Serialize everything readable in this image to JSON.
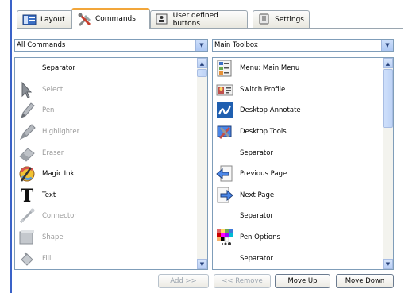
{
  "tabs": [
    {
      "label": "Layout",
      "icon": "layout-icon"
    },
    {
      "label": "Commands",
      "icon": "tools-icon",
      "active": true
    },
    {
      "label": "User defined buttons",
      "icon": "user-button-icon"
    },
    {
      "label": "Settings",
      "icon": "settings-icon"
    }
  ],
  "left_combo": {
    "value": "All Commands"
  },
  "right_combo": {
    "value": "Main Toolbox"
  },
  "left_list": [
    {
      "label": "Separator",
      "icon": "",
      "enabled": true
    },
    {
      "label": "Select",
      "icon": "select-arrow-icon",
      "enabled": false
    },
    {
      "label": "Pen",
      "icon": "pen-icon",
      "enabled": false
    },
    {
      "label": "Highlighter",
      "icon": "highlighter-icon",
      "enabled": false
    },
    {
      "label": "Eraser",
      "icon": "eraser-icon",
      "enabled": false
    },
    {
      "label": "Magic Ink",
      "icon": "magic-ink-icon",
      "enabled": true
    },
    {
      "label": "Text",
      "icon": "text-icon",
      "enabled": true
    },
    {
      "label": "Connector",
      "icon": "connector-icon",
      "enabled": false
    },
    {
      "label": "Shape",
      "icon": "shape-icon",
      "enabled": false
    },
    {
      "label": "Fill",
      "icon": "fill-icon",
      "enabled": false
    }
  ],
  "right_list": [
    {
      "label": "Menu: Main Menu",
      "icon": "main-menu-icon"
    },
    {
      "label": "Switch Profile",
      "icon": "switch-profile-icon"
    },
    {
      "label": "Desktop Annotate",
      "icon": "desktop-annotate-icon"
    },
    {
      "label": "Desktop Tools",
      "icon": "desktop-tools-icon"
    },
    {
      "label": "Separator",
      "icon": ""
    },
    {
      "label": "Previous Page",
      "icon": "previous-page-icon"
    },
    {
      "label": "Next Page",
      "icon": "next-page-icon"
    },
    {
      "label": "Separator",
      "icon": ""
    },
    {
      "label": "Pen Options",
      "icon": "pen-options-icon"
    },
    {
      "label": "Separator",
      "icon": ""
    }
  ],
  "buttons": {
    "add": "Add >>",
    "remove": "<< Remove",
    "move_up": "Move Up",
    "move_down": "Move Down"
  },
  "colors": {
    "accent_tab": "#f2a63a",
    "border": "#7f9db9",
    "side_bar": "#3a62c8"
  }
}
